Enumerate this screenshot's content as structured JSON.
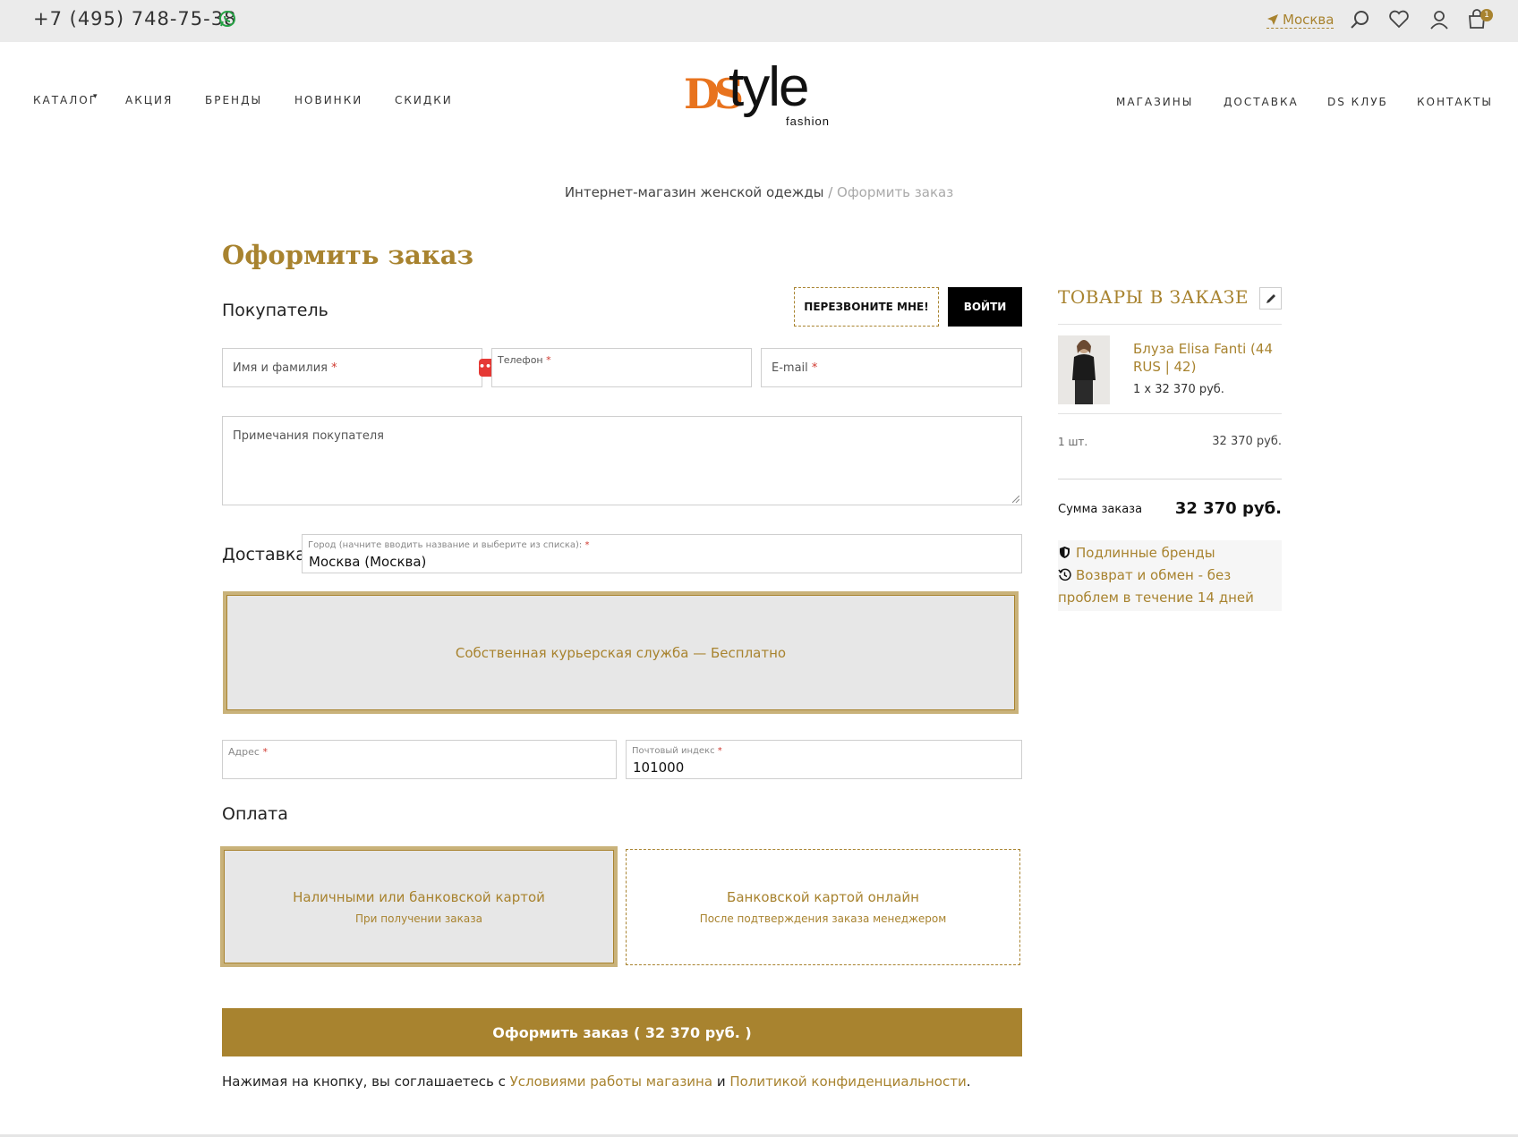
{
  "topbar": {
    "phone": "+7 (495) 748-75-38",
    "city": "Москва",
    "cart_count": "1"
  },
  "nav": {
    "left": [
      "КАТАЛОГ",
      "АКЦИЯ",
      "БРЕНДЫ",
      "НОВИНКИ",
      "СКИДКИ"
    ],
    "right": [
      "МАГАЗИНЫ",
      "ДОСТАВКА",
      "DS КЛУБ",
      "КОНТАКТЫ"
    ]
  },
  "logo": {
    "mark": "DS",
    "word": "tyle",
    "sub": "fashion"
  },
  "breadcrumb": {
    "home": "Интернет-магазин женской одежды",
    "sep": " / ",
    "current": "Оформить заказ"
  },
  "page_title": "Оформить заказ",
  "buyer": {
    "title": "Покупатель",
    "callback_label": "ПЕРЕЗВОНИТЕ МНЕ!",
    "login_label": "ВОЙТИ",
    "name_placeholder": "Имя и фамилия",
    "phone_placeholder": "Телефон",
    "email_placeholder": "E-mail",
    "notes_placeholder": "Примечания покупателя",
    "required_mark": "*"
  },
  "delivery": {
    "title": "Доставка",
    "city_label": "Город (начните вводить название и выберите из списка):",
    "city_value": "Москва (Москва)",
    "option": "Собственная курьерская служба — Бесплатно",
    "address_label": "Адрес",
    "postcode_label": "Почтовый индекс",
    "postcode_value": "101000"
  },
  "payment": {
    "title": "Оплата",
    "options": [
      {
        "title": "Наличными или банковской картой",
        "sub": "При получении заказа",
        "selected": true
      },
      {
        "title": "Банковской картой онлайн",
        "sub": "После подтверждения заказа менеджером",
        "selected": false
      }
    ]
  },
  "submit_label": "Оформить заказ ( 32 370 руб. )",
  "agreement": {
    "prefix": "Нажимая на кнопку, вы соглашаетесь с ",
    "terms": "Условиями работы магазина",
    "and": " и ",
    "privacy": "Политикой конфиденциальности",
    "suffix": "."
  },
  "order": {
    "title": "ТОВАРЫ В ЗАКАЗЕ",
    "product_name": "Блуза Elisa Fanti (44 RUS | 42)",
    "product_qty": "1 x 32 370 руб.",
    "count": "1 шт.",
    "count_price": "32 370 руб.",
    "sum_label": "Сумма заказа",
    "sum_value": "32 370 руб.",
    "perks": [
      "Подлинные бренды",
      "Возврат и обмен - без проблем в течение 14 дней"
    ]
  },
  "colors": {
    "accent": "#a8832f",
    "dark": "#000000",
    "topbar": "#ebebeb"
  }
}
